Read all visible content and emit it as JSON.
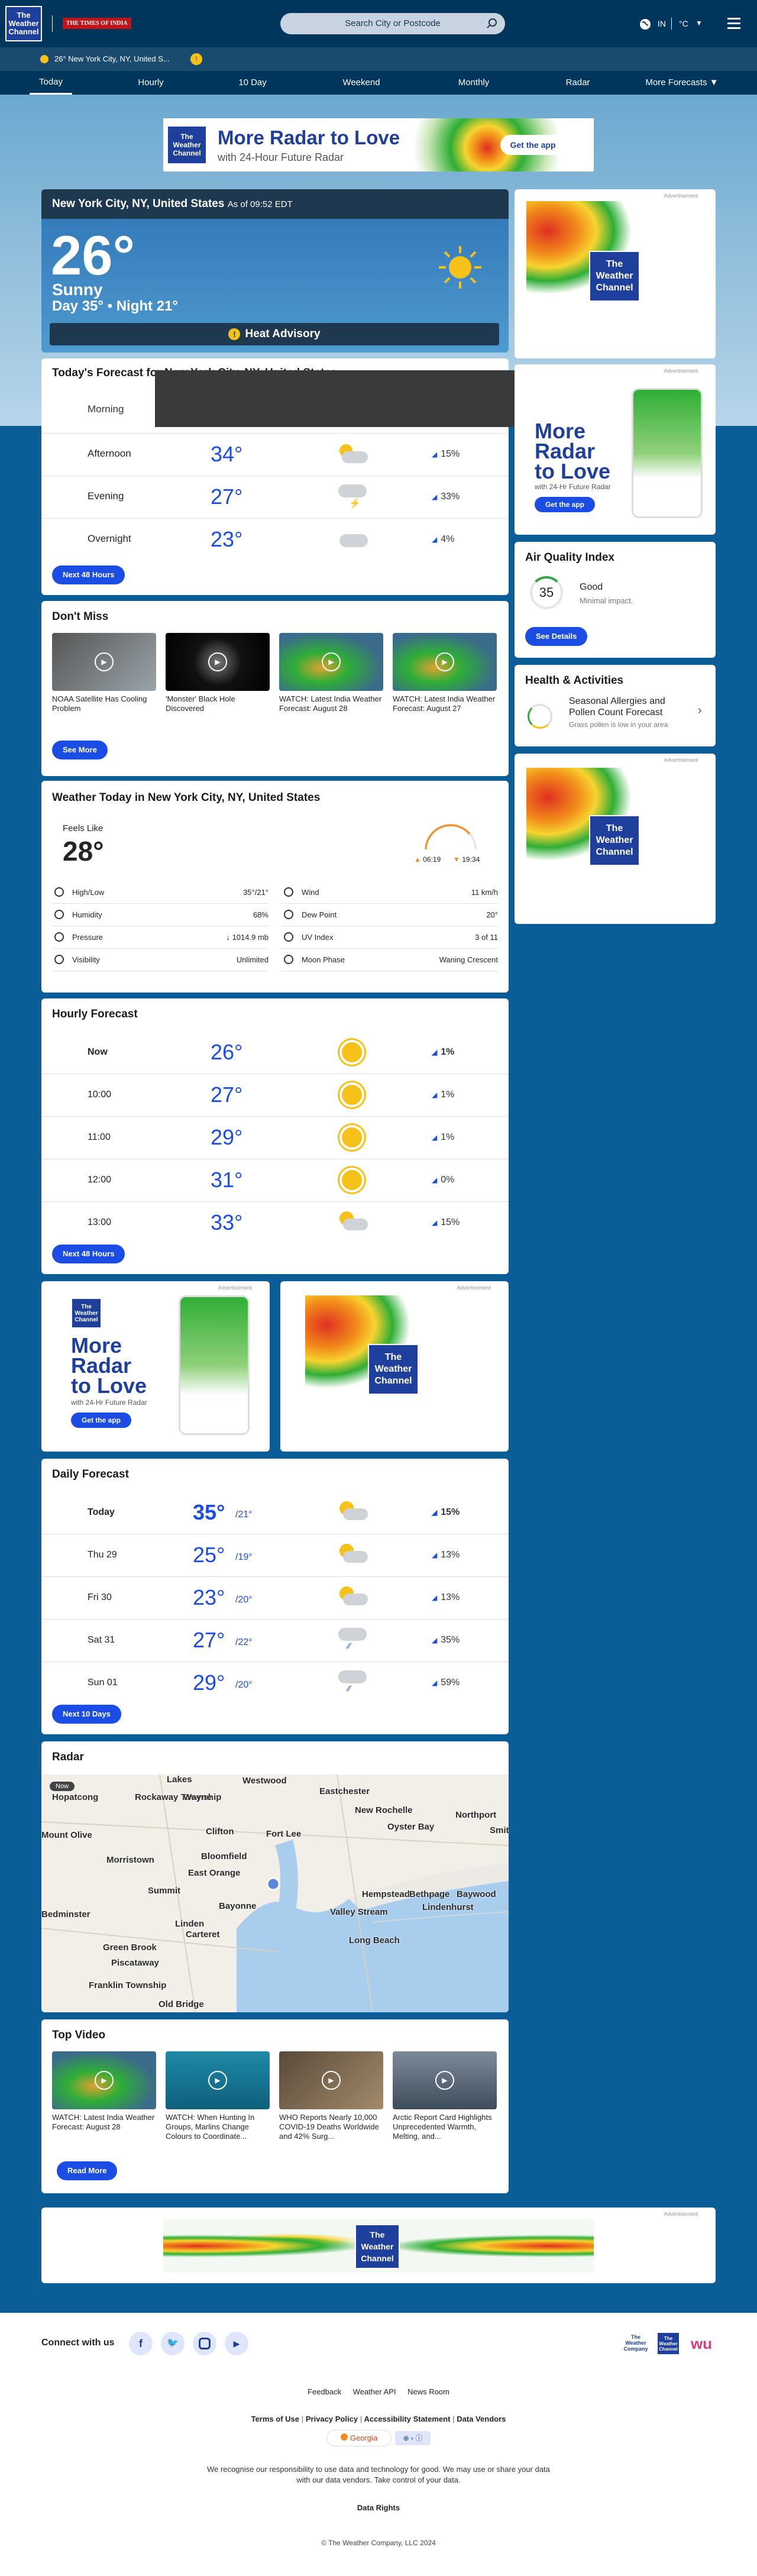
{
  "header": {
    "logo_text": "The Weather Channel",
    "partner": "THE TIMES OF INDIA",
    "search_placeholder": "Search City or Postcode",
    "region": "IN",
    "unit": "°C",
    "recent_location": "26° New York City, NY, United S..."
  },
  "nav": {
    "tabs": [
      "Today",
      "Hourly",
      "10 Day",
      "Weekend",
      "Monthly",
      "Radar",
      "More Forecasts"
    ]
  },
  "banner_ad": {
    "title": "More Radar to Love",
    "subtitle": "with 24-Hour Future Radar",
    "cta": "Get the app",
    "logo": "The Weather Channel"
  },
  "current": {
    "location": "New York City, NY, United States",
    "as_of": "As of 09:52 EDT",
    "temp": "26°",
    "condition": "Sunny",
    "day_night": "Day 35° • Night 21°",
    "alert": "Heat Advisory"
  },
  "todays_forecast": {
    "title": "Today's Forecast for New York City, NY, United States",
    "rows": [
      {
        "period": "Morning",
        "temp": "",
        "precip": ""
      },
      {
        "period": "Afternoon",
        "temp": "34°",
        "precip": "15%"
      },
      {
        "period": "Evening",
        "temp": "27°",
        "precip": "33%"
      },
      {
        "period": "Overnight",
        "temp": "23°",
        "precip": "4%"
      }
    ],
    "button": "Next 48 Hours"
  },
  "side_ads": {
    "advertisement": "Advertisement",
    "logo": "The Weather Channel",
    "radar_title": [
      "More",
      "Radar",
      "to Love"
    ],
    "radar_sub": "with 24-Hr Future Radar",
    "cta": "Get the app"
  },
  "aqi": {
    "title": "Air Quality Index",
    "value": "35",
    "label": "Good",
    "desc": "Minimal impact.",
    "button": "See Details"
  },
  "health": {
    "title": "Health & Activities",
    "item_title": "Seasonal Allergies and Pollen Count Forecast",
    "item_desc": "Grass pollen is low in your area"
  },
  "dont_miss": {
    "title": "Don't Miss",
    "items": [
      "NOAA Satellite Has Cooling Problem",
      "'Monster' Black Hole Discovered",
      "WATCH: Latest India Weather Forecast: August 28",
      "WATCH: Latest India Weather Forecast: August 27"
    ],
    "button": "See More"
  },
  "today_details": {
    "title": "Weather Today in New York City, NY, United States",
    "feels_like_label": "Feels Like",
    "feels_like": "28°",
    "sunrise": "06:19",
    "sunset": "19:34",
    "left": [
      {
        "label": "High/Low",
        "value": "35°/21°",
        "icon": "thermometer-icon"
      },
      {
        "label": "Humidity",
        "value": "68%",
        "icon": "humidity-icon"
      },
      {
        "label": "Pressure",
        "value": "↓ 1014.9 mb",
        "icon": "pressure-icon"
      },
      {
        "label": "Visibility",
        "value": "Unlimited",
        "icon": "visibility-icon"
      }
    ],
    "right": [
      {
        "label": "Wind",
        "value": "11 km/h",
        "icon": "wind-icon"
      },
      {
        "label": "Dew Point",
        "value": "20°",
        "icon": "dew-point-icon"
      },
      {
        "label": "UV Index",
        "value": "3 of 11",
        "icon": "uv-icon"
      },
      {
        "label": "Moon Phase",
        "value": "Waning Crescent",
        "icon": "moon-icon"
      }
    ]
  },
  "hourly": {
    "title": "Hourly Forecast",
    "rows": [
      {
        "time": "Now",
        "temp": "26°",
        "precip": "1%",
        "icon": "sun"
      },
      {
        "time": "10:00",
        "temp": "27°",
        "precip": "1%",
        "icon": "sun"
      },
      {
        "time": "11:00",
        "temp": "29°",
        "precip": "1%",
        "icon": "sun"
      },
      {
        "time": "12:00",
        "temp": "31°",
        "precip": "0%",
        "icon": "sun"
      },
      {
        "time": "13:00",
        "temp": "33°",
        "precip": "15%",
        "icon": "partly"
      }
    ],
    "button": "Next 48 Hours"
  },
  "daily": {
    "title": "Daily Forecast",
    "rows": [
      {
        "day": "Today",
        "high": "35°",
        "low": "/21°",
        "precip": "15%",
        "icon": "partly-sun"
      },
      {
        "day": "Thu 29",
        "high": "25°",
        "low": "/19°",
        "precip": "13%",
        "icon": "partly-sun"
      },
      {
        "day": "Fri 30",
        "high": "23°",
        "low": "/20°",
        "precip": "13%",
        "icon": "partly-sun"
      },
      {
        "day": "Sat 31",
        "high": "27°",
        "low": "/22°",
        "precip": "35%",
        "icon": "rain"
      },
      {
        "day": "Sun 01",
        "high": "29°",
        "low": "/20°",
        "precip": "59%",
        "icon": "rain"
      }
    ],
    "button": "Next 10 Days"
  },
  "radar": {
    "title": "Radar",
    "now": "Now",
    "places": [
      "Lakes",
      "Westwood",
      "Hopatcong",
      "Rockaway Township",
      "Wayne",
      "Eastchester",
      "New Rochelle",
      "Northport",
      "Oyster Bay",
      "Smithtown",
      "Clifton",
      "Fort Lee",
      "Morristown",
      "Bloomfield",
      "East Orange",
      "Summit",
      "Bayonne",
      "Hempstead",
      "Bethpage",
      "Baywood",
      "Lindenhurst",
      "Valley Stream",
      "Bedminster",
      "Linden",
      "Carteret",
      "Green Brook",
      "Piscataway",
      "Long Beach",
      "Franklin Township",
      "Old Bridge",
      "Mount Olive"
    ]
  },
  "top_video": {
    "title": "Top Video",
    "items": [
      "WATCH: Latest India Weather Forecast: August 28",
      "WATCH: When Hunting In Groups, Marlins Change Colours to Coordinate...",
      "WHO Reports Nearly 10,000 COVID-19 Deaths Worldwide and 42% Surg...",
      "Arctic Report Card Highlights Unprecedented Warmth, Melting, and..."
    ],
    "button": "Read More"
  },
  "footer": {
    "connect": "Connect with us",
    "links1": [
      "Feedback",
      "Weather API",
      "News Room"
    ],
    "links2": [
      "Terms of Use",
      "Privacy Policy",
      "Accessibility Statement",
      "Data Vendors"
    ],
    "georgia": "Georgia",
    "note": "We recognise our responsibility to use data and technology for good. We may use or share your data with our data vendors. Take control of your data.",
    "data_rights": "Data Rights",
    "copyright": "© The Weather Company, LLC 2024",
    "brand_logos": [
      "The Weather Company",
      "The Weather Channel",
      "wu"
    ]
  },
  "colors": {
    "primary": "#1b4de4",
    "navy": "#00355c",
    "bg": "#0a5d96"
  }
}
